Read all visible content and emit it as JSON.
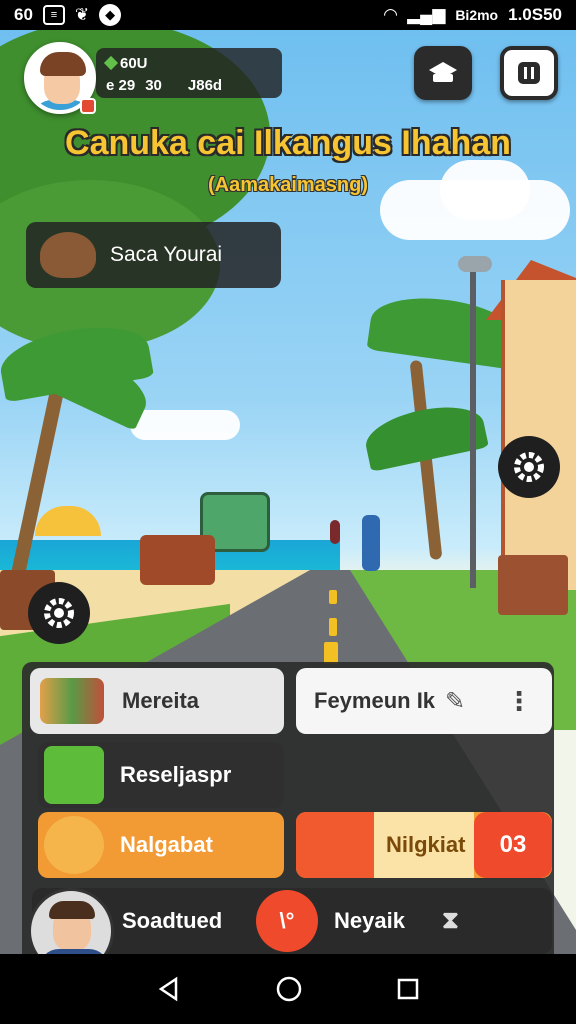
{
  "status_bar": {
    "left_text": "60",
    "left_icon_box": "≡",
    "network": "Bi2mo",
    "time": "1.0S50"
  },
  "hud": {
    "stat_top": "60U",
    "stat_left": "e 29",
    "stat_mid": "30",
    "stat_right": "J86d"
  },
  "title": {
    "main": "Canuka cai Ilkangus Ihahan",
    "sub": "(Aamakaimasng)"
  },
  "journal": {
    "label": "Saca Yourai"
  },
  "panel": {
    "merita_label": "Mereita",
    "payment_label": "Feymeun Ik",
    "resel_label": "Reseljaspr",
    "nalg_label": "Nalgabat",
    "nilg_label": "Nilgkiat",
    "nilg_count": "03",
    "bottom_left_label": "Soadtued",
    "red_button_label": "\\°",
    "bottom_right_label": "Neyaik"
  },
  "colors": {
    "accent_title": "#f7c531",
    "panel_bg": "#2d2d2d",
    "orange": "#f29a34",
    "red": "#f04a2c",
    "green_icon": "#5dbd3a"
  },
  "icons": [
    "gem-icon",
    "hat-icon",
    "pause-icon",
    "bowl-icon",
    "gear-icon",
    "people-icon",
    "pencil-icon",
    "more-vert-icon",
    "basket-icon",
    "mascot-icon",
    "hourglass-icon",
    "back-icon",
    "home-icon",
    "recents-icon"
  ]
}
